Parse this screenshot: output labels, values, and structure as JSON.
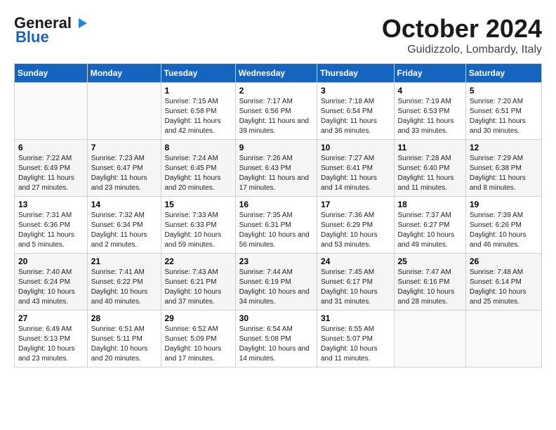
{
  "logo": {
    "line1": "General",
    "line2": "Blue"
  },
  "title": "October 2024",
  "location": "Guidizzolo, Lombardy, Italy",
  "headers": [
    "Sunday",
    "Monday",
    "Tuesday",
    "Wednesday",
    "Thursday",
    "Friday",
    "Saturday"
  ],
  "weeks": [
    [
      {
        "day": "",
        "sunrise": "",
        "sunset": "",
        "daylight": ""
      },
      {
        "day": "",
        "sunrise": "",
        "sunset": "",
        "daylight": ""
      },
      {
        "day": "1",
        "sunrise": "Sunrise: 7:15 AM",
        "sunset": "Sunset: 6:58 PM",
        "daylight": "Daylight: 11 hours and 42 minutes."
      },
      {
        "day": "2",
        "sunrise": "Sunrise: 7:17 AM",
        "sunset": "Sunset: 6:56 PM",
        "daylight": "Daylight: 11 hours and 39 minutes."
      },
      {
        "day": "3",
        "sunrise": "Sunrise: 7:18 AM",
        "sunset": "Sunset: 6:54 PM",
        "daylight": "Daylight: 11 hours and 36 minutes."
      },
      {
        "day": "4",
        "sunrise": "Sunrise: 7:19 AM",
        "sunset": "Sunset: 6:53 PM",
        "daylight": "Daylight: 11 hours and 33 minutes."
      },
      {
        "day": "5",
        "sunrise": "Sunrise: 7:20 AM",
        "sunset": "Sunset: 6:51 PM",
        "daylight": "Daylight: 11 hours and 30 minutes."
      }
    ],
    [
      {
        "day": "6",
        "sunrise": "Sunrise: 7:22 AM",
        "sunset": "Sunset: 6:49 PM",
        "daylight": "Daylight: 11 hours and 27 minutes."
      },
      {
        "day": "7",
        "sunrise": "Sunrise: 7:23 AM",
        "sunset": "Sunset: 6:47 PM",
        "daylight": "Daylight: 11 hours and 23 minutes."
      },
      {
        "day": "8",
        "sunrise": "Sunrise: 7:24 AM",
        "sunset": "Sunset: 6:45 PM",
        "daylight": "Daylight: 11 hours and 20 minutes."
      },
      {
        "day": "9",
        "sunrise": "Sunrise: 7:26 AM",
        "sunset": "Sunset: 6:43 PM",
        "daylight": "Daylight: 11 hours and 17 minutes."
      },
      {
        "day": "10",
        "sunrise": "Sunrise: 7:27 AM",
        "sunset": "Sunset: 6:41 PM",
        "daylight": "Daylight: 11 hours and 14 minutes."
      },
      {
        "day": "11",
        "sunrise": "Sunrise: 7:28 AM",
        "sunset": "Sunset: 6:40 PM",
        "daylight": "Daylight: 11 hours and 11 minutes."
      },
      {
        "day": "12",
        "sunrise": "Sunrise: 7:29 AM",
        "sunset": "Sunset: 6:38 PM",
        "daylight": "Daylight: 11 hours and 8 minutes."
      }
    ],
    [
      {
        "day": "13",
        "sunrise": "Sunrise: 7:31 AM",
        "sunset": "Sunset: 6:36 PM",
        "daylight": "Daylight: 11 hours and 5 minutes."
      },
      {
        "day": "14",
        "sunrise": "Sunrise: 7:32 AM",
        "sunset": "Sunset: 6:34 PM",
        "daylight": "Daylight: 11 hours and 2 minutes."
      },
      {
        "day": "15",
        "sunrise": "Sunrise: 7:33 AM",
        "sunset": "Sunset: 6:33 PM",
        "daylight": "Daylight: 10 hours and 59 minutes."
      },
      {
        "day": "16",
        "sunrise": "Sunrise: 7:35 AM",
        "sunset": "Sunset: 6:31 PM",
        "daylight": "Daylight: 10 hours and 56 minutes."
      },
      {
        "day": "17",
        "sunrise": "Sunrise: 7:36 AM",
        "sunset": "Sunset: 6:29 PM",
        "daylight": "Daylight: 10 hours and 53 minutes."
      },
      {
        "day": "18",
        "sunrise": "Sunrise: 7:37 AM",
        "sunset": "Sunset: 6:27 PM",
        "daylight": "Daylight: 10 hours and 49 minutes."
      },
      {
        "day": "19",
        "sunrise": "Sunrise: 7:39 AM",
        "sunset": "Sunset: 6:26 PM",
        "daylight": "Daylight: 10 hours and 46 minutes."
      }
    ],
    [
      {
        "day": "20",
        "sunrise": "Sunrise: 7:40 AM",
        "sunset": "Sunset: 6:24 PM",
        "daylight": "Daylight: 10 hours and 43 minutes."
      },
      {
        "day": "21",
        "sunrise": "Sunrise: 7:41 AM",
        "sunset": "Sunset: 6:22 PM",
        "daylight": "Daylight: 10 hours and 40 minutes."
      },
      {
        "day": "22",
        "sunrise": "Sunrise: 7:43 AM",
        "sunset": "Sunset: 6:21 PM",
        "daylight": "Daylight: 10 hours and 37 minutes."
      },
      {
        "day": "23",
        "sunrise": "Sunrise: 7:44 AM",
        "sunset": "Sunset: 6:19 PM",
        "daylight": "Daylight: 10 hours and 34 minutes."
      },
      {
        "day": "24",
        "sunrise": "Sunrise: 7:45 AM",
        "sunset": "Sunset: 6:17 PM",
        "daylight": "Daylight: 10 hours and 31 minutes."
      },
      {
        "day": "25",
        "sunrise": "Sunrise: 7:47 AM",
        "sunset": "Sunset: 6:16 PM",
        "daylight": "Daylight: 10 hours and 28 minutes."
      },
      {
        "day": "26",
        "sunrise": "Sunrise: 7:48 AM",
        "sunset": "Sunset: 6:14 PM",
        "daylight": "Daylight: 10 hours and 25 minutes."
      }
    ],
    [
      {
        "day": "27",
        "sunrise": "Sunrise: 6:49 AM",
        "sunset": "Sunset: 5:13 PM",
        "daylight": "Daylight: 10 hours and 23 minutes."
      },
      {
        "day": "28",
        "sunrise": "Sunrise: 6:51 AM",
        "sunset": "Sunset: 5:11 PM",
        "daylight": "Daylight: 10 hours and 20 minutes."
      },
      {
        "day": "29",
        "sunrise": "Sunrise: 6:52 AM",
        "sunset": "Sunset: 5:09 PM",
        "daylight": "Daylight: 10 hours and 17 minutes."
      },
      {
        "day": "30",
        "sunrise": "Sunrise: 6:54 AM",
        "sunset": "Sunset: 5:08 PM",
        "daylight": "Daylight: 10 hours and 14 minutes."
      },
      {
        "day": "31",
        "sunrise": "Sunrise: 6:55 AM",
        "sunset": "Sunset: 5:07 PM",
        "daylight": "Daylight: 10 hours and 11 minutes."
      },
      {
        "day": "",
        "sunrise": "",
        "sunset": "",
        "daylight": ""
      },
      {
        "day": "",
        "sunrise": "",
        "sunset": "",
        "daylight": ""
      }
    ]
  ]
}
